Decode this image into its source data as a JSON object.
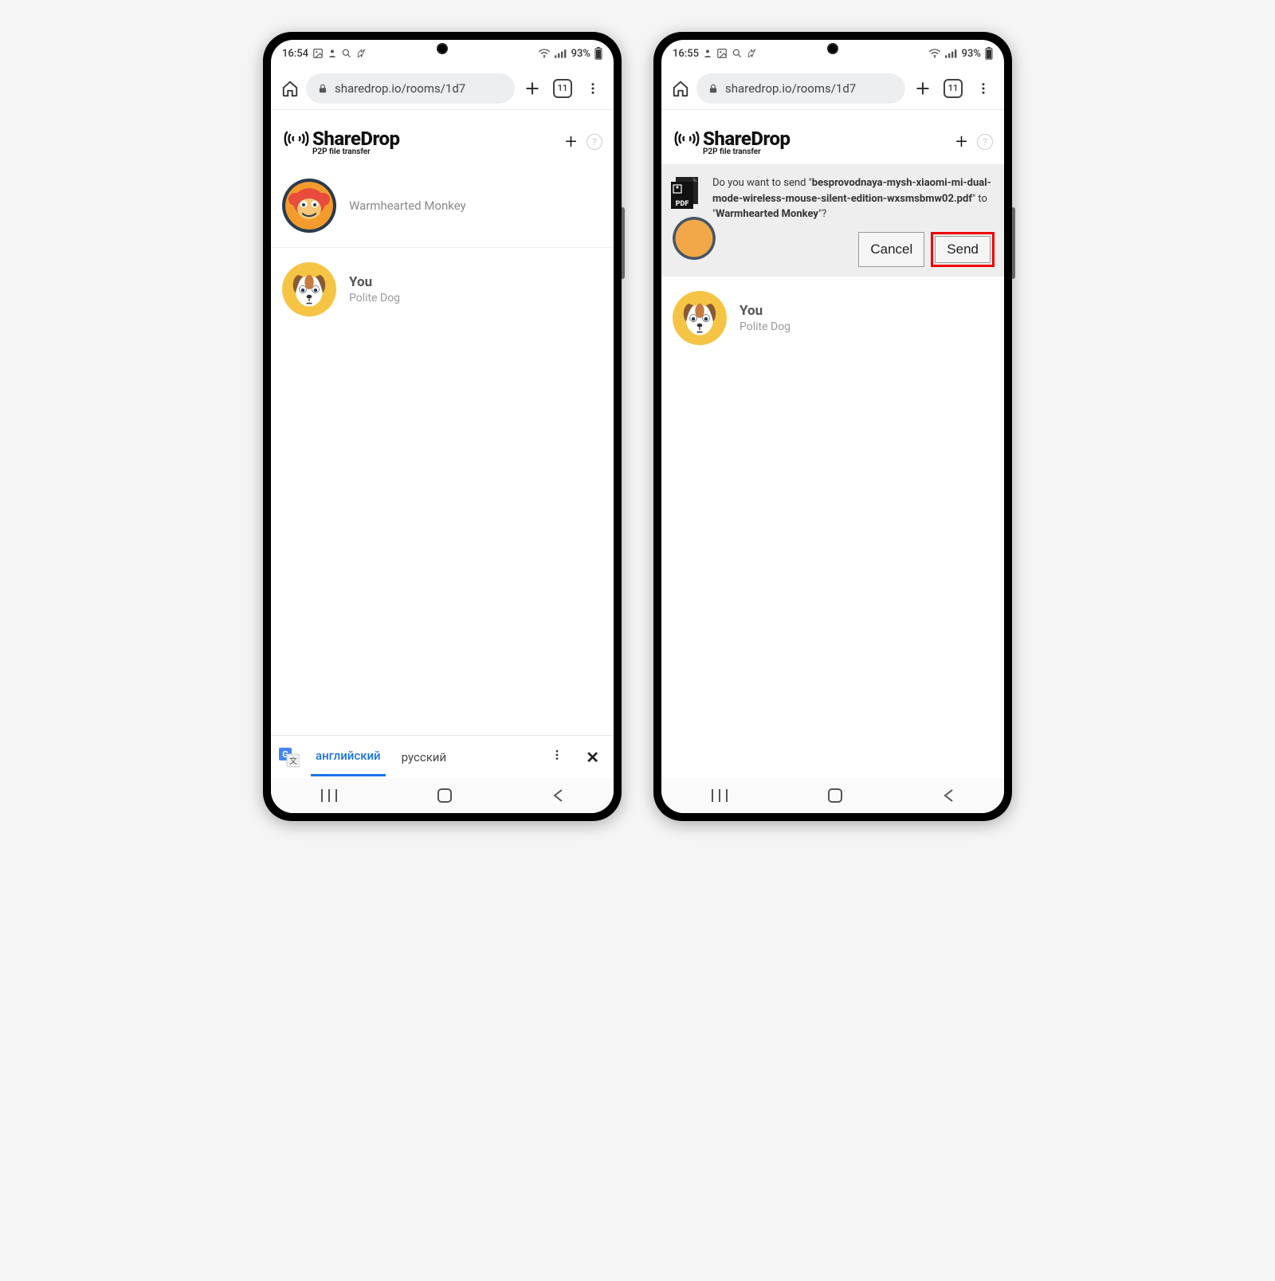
{
  "left": {
    "status": {
      "time": "16:54",
      "battery": "93%"
    },
    "browser": {
      "url": "sharedrop.io/rooms/1d7",
      "tabs": "11"
    },
    "app": {
      "name": "ShareDrop",
      "tag": "P2P file transfer"
    },
    "peer": {
      "name": "Warmhearted Monkey"
    },
    "you": {
      "label": "You",
      "name": "Polite Dog"
    },
    "translate": {
      "lang1": "английский",
      "lang2": "русский"
    }
  },
  "right": {
    "status": {
      "time": "16:55",
      "battery": "93%"
    },
    "browser": {
      "url": "sharedrop.io/rooms/1d7",
      "tabs": "11"
    },
    "app": {
      "name": "ShareDrop",
      "tag": "P2P file transfer"
    },
    "confirm": {
      "pre": "Do you want to send \"",
      "file": "besprovodnaya-mysh-xiaomi-mi-dual-mode-wireless-mouse-silent-edition-wxsmsbmw02.pdf",
      "mid": "\" to \"",
      "target": "Warmhearted Monkey",
      "post": "\"?",
      "cancel": "Cancel",
      "send": "Send"
    },
    "you": {
      "label": "You",
      "name": "Polite Dog"
    }
  }
}
